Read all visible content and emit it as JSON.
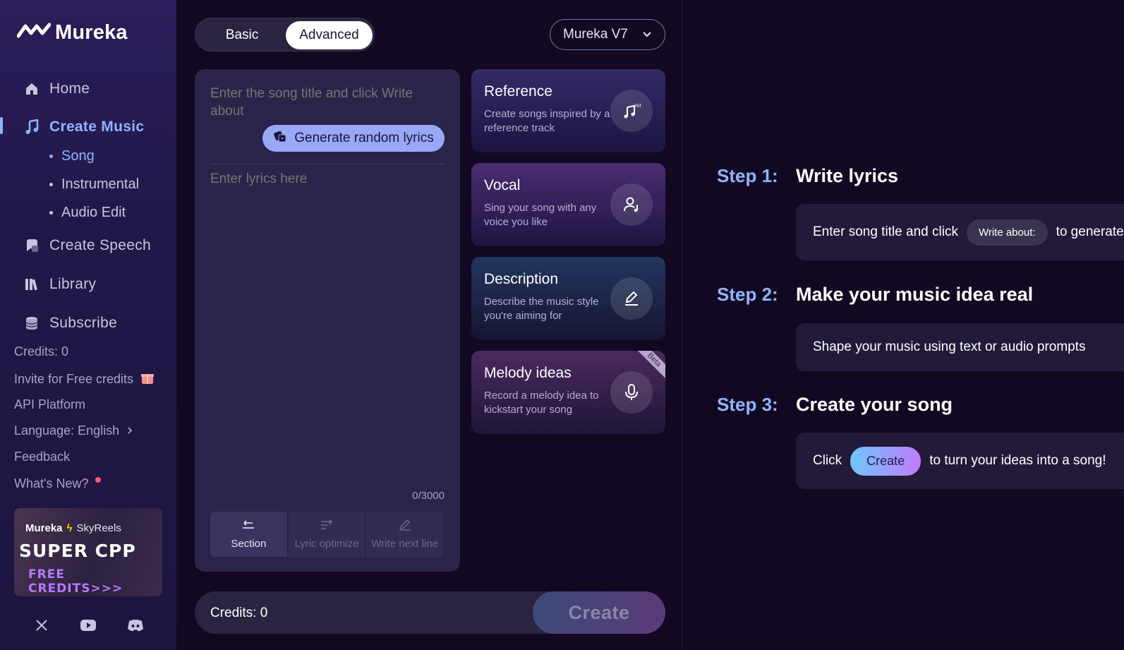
{
  "brand": {
    "name": "Mureka"
  },
  "nav": {
    "home": "Home",
    "create_music": "Create Music",
    "song": "Song",
    "instrumental": "Instrumental",
    "audio_edit": "Audio Edit",
    "create_speech": "Create Speech",
    "library": "Library",
    "subscribe": "Subscribe"
  },
  "sidebar_links": {
    "credits": "Credits: 0",
    "invite": "Invite for Free credits",
    "api": "API Platform",
    "language": "Language: English",
    "feedback": "Feedback",
    "whats_new": "What's New?"
  },
  "promo": {
    "brand1": "Mureka",
    "brand2": "SkyReels",
    "headline": "SUPER CPP",
    "sub": "FREE CREDITS>>>"
  },
  "mode": {
    "basic": "Basic",
    "advanced": "Advanced"
  },
  "model": {
    "selected": "Mureka V7"
  },
  "lyrics": {
    "title_placeholder": "Enter the song title and click Write about",
    "generate_label": "Generate random lyrics",
    "lyrics_placeholder": "Enter lyrics here",
    "counter": "0/3000",
    "tools": {
      "section": "Section",
      "optimize": "Lyric optimize",
      "next_line": "Write next line"
    }
  },
  "cards": [
    {
      "title": "Reference",
      "desc": "Create songs inspired by a reference track"
    },
    {
      "title": "Vocal",
      "desc": "Sing your song with any voice you like"
    },
    {
      "title": "Description",
      "desc": "Describe the music style you're aiming for"
    },
    {
      "title": "Melody ideas",
      "desc": "Record a melody idea to kickstart your song",
      "badge": "Beta"
    }
  ],
  "bottom": {
    "credits": "Credits: 0",
    "create": "Create"
  },
  "steps": [
    {
      "num": "Step 1:",
      "title": "Write lyrics",
      "text_before": "Enter song title and click",
      "pill": "Write about:",
      "text_after": "to generate"
    },
    {
      "num": "Step 2:",
      "title": "Make your music idea real",
      "text": "Shape your music using text or audio prompts"
    },
    {
      "num": "Step 3:",
      "title": "Create your song",
      "text_before": "Click",
      "pill": "Create",
      "text_after": "to turn your ideas into a song!"
    }
  ],
  "colors": {
    "accent": "#8fb4ff",
    "background": "#120822",
    "sidebar": "#221848"
  }
}
